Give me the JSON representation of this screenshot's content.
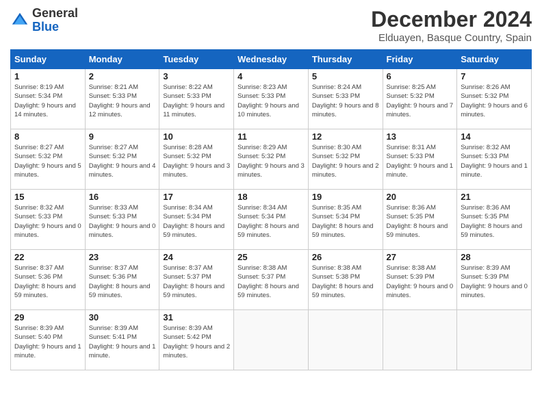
{
  "logo": {
    "general": "General",
    "blue": "Blue"
  },
  "title": "December 2024",
  "subtitle": "Elduayen, Basque Country, Spain",
  "weekdays": [
    "Sunday",
    "Monday",
    "Tuesday",
    "Wednesday",
    "Thursday",
    "Friday",
    "Saturday"
  ],
  "weeks": [
    [
      {
        "day": "1",
        "sunrise": "8:19 AM",
        "sunset": "5:34 PM",
        "daylight": "9 hours and 14 minutes."
      },
      {
        "day": "2",
        "sunrise": "8:21 AM",
        "sunset": "5:33 PM",
        "daylight": "9 hours and 12 minutes."
      },
      {
        "day": "3",
        "sunrise": "8:22 AM",
        "sunset": "5:33 PM",
        "daylight": "9 hours and 11 minutes."
      },
      {
        "day": "4",
        "sunrise": "8:23 AM",
        "sunset": "5:33 PM",
        "daylight": "9 hours and 10 minutes."
      },
      {
        "day": "5",
        "sunrise": "8:24 AM",
        "sunset": "5:33 PM",
        "daylight": "9 hours and 8 minutes."
      },
      {
        "day": "6",
        "sunrise": "8:25 AM",
        "sunset": "5:32 PM",
        "daylight": "9 hours and 7 minutes."
      },
      {
        "day": "7",
        "sunrise": "8:26 AM",
        "sunset": "5:32 PM",
        "daylight": "9 hours and 6 minutes."
      }
    ],
    [
      {
        "day": "8",
        "sunrise": "8:27 AM",
        "sunset": "5:32 PM",
        "daylight": "9 hours and 5 minutes."
      },
      {
        "day": "9",
        "sunrise": "8:27 AM",
        "sunset": "5:32 PM",
        "daylight": "9 hours and 4 minutes."
      },
      {
        "day": "10",
        "sunrise": "8:28 AM",
        "sunset": "5:32 PM",
        "daylight": "9 hours and 3 minutes."
      },
      {
        "day": "11",
        "sunrise": "8:29 AM",
        "sunset": "5:32 PM",
        "daylight": "9 hours and 3 minutes."
      },
      {
        "day": "12",
        "sunrise": "8:30 AM",
        "sunset": "5:32 PM",
        "daylight": "9 hours and 2 minutes."
      },
      {
        "day": "13",
        "sunrise": "8:31 AM",
        "sunset": "5:33 PM",
        "daylight": "9 hours and 1 minute."
      },
      {
        "day": "14",
        "sunrise": "8:32 AM",
        "sunset": "5:33 PM",
        "daylight": "9 hours and 1 minute."
      }
    ],
    [
      {
        "day": "15",
        "sunrise": "8:32 AM",
        "sunset": "5:33 PM",
        "daylight": "9 hours and 0 minutes."
      },
      {
        "day": "16",
        "sunrise": "8:33 AM",
        "sunset": "5:33 PM",
        "daylight": "9 hours and 0 minutes."
      },
      {
        "day": "17",
        "sunrise": "8:34 AM",
        "sunset": "5:34 PM",
        "daylight": "8 hours and 59 minutes."
      },
      {
        "day": "18",
        "sunrise": "8:34 AM",
        "sunset": "5:34 PM",
        "daylight": "8 hours and 59 minutes."
      },
      {
        "day": "19",
        "sunrise": "8:35 AM",
        "sunset": "5:34 PM",
        "daylight": "8 hours and 59 minutes."
      },
      {
        "day": "20",
        "sunrise": "8:36 AM",
        "sunset": "5:35 PM",
        "daylight": "8 hours and 59 minutes."
      },
      {
        "day": "21",
        "sunrise": "8:36 AM",
        "sunset": "5:35 PM",
        "daylight": "8 hours and 59 minutes."
      }
    ],
    [
      {
        "day": "22",
        "sunrise": "8:37 AM",
        "sunset": "5:36 PM",
        "daylight": "8 hours and 59 minutes."
      },
      {
        "day": "23",
        "sunrise": "8:37 AM",
        "sunset": "5:36 PM",
        "daylight": "8 hours and 59 minutes."
      },
      {
        "day": "24",
        "sunrise": "8:37 AM",
        "sunset": "5:37 PM",
        "daylight": "8 hours and 59 minutes."
      },
      {
        "day": "25",
        "sunrise": "8:38 AM",
        "sunset": "5:37 PM",
        "daylight": "8 hours and 59 minutes."
      },
      {
        "day": "26",
        "sunrise": "8:38 AM",
        "sunset": "5:38 PM",
        "daylight": "8 hours and 59 minutes."
      },
      {
        "day": "27",
        "sunrise": "8:38 AM",
        "sunset": "5:39 PM",
        "daylight": "9 hours and 0 minutes."
      },
      {
        "day": "28",
        "sunrise": "8:39 AM",
        "sunset": "5:39 PM",
        "daylight": "9 hours and 0 minutes."
      }
    ],
    [
      {
        "day": "29",
        "sunrise": "8:39 AM",
        "sunset": "5:40 PM",
        "daylight": "9 hours and 1 minute."
      },
      {
        "day": "30",
        "sunrise": "8:39 AM",
        "sunset": "5:41 PM",
        "daylight": "9 hours and 1 minute."
      },
      {
        "day": "31",
        "sunrise": "8:39 AM",
        "sunset": "5:42 PM",
        "daylight": "9 hours and 2 minutes."
      },
      null,
      null,
      null,
      null
    ]
  ]
}
